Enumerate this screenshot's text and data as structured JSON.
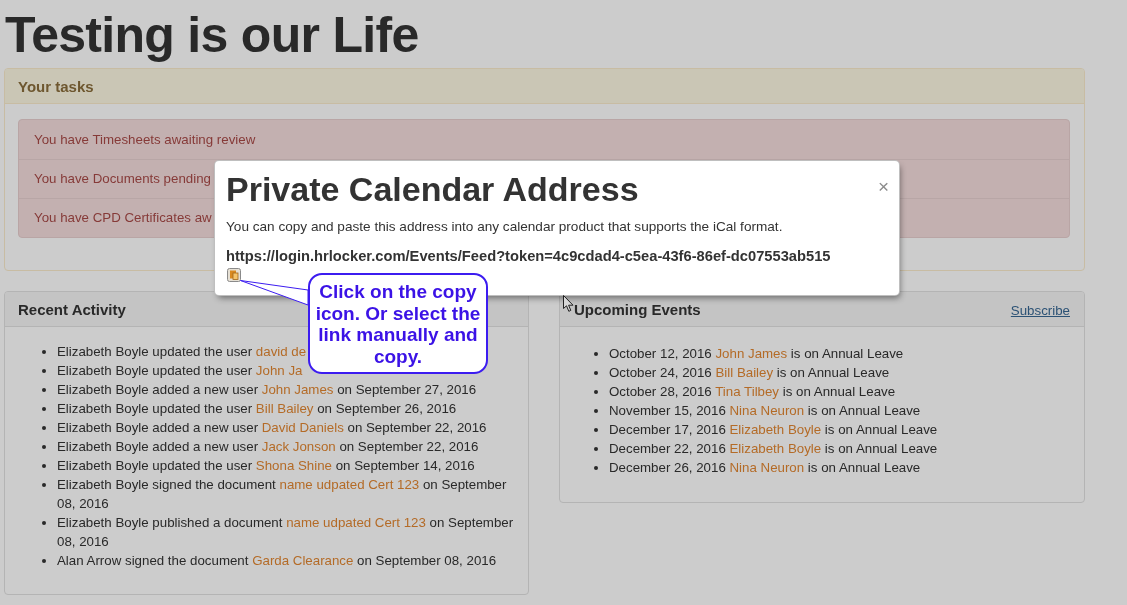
{
  "page": {
    "title": "Testing is our Life"
  },
  "tasks": {
    "title": "Your tasks",
    "items": [
      "You have Timesheets awaiting review",
      "You have Documents pending",
      "You have CPD Certificates aw"
    ]
  },
  "recent_activity": {
    "title": "Recent Activity",
    "items": [
      {
        "before": "Elizabeth Boyle updated the user",
        "link": "david de"
      },
      {
        "before": "Elizabeth Boyle updated the user",
        "link": "John Ja"
      },
      {
        "before": "Elizabeth Boyle added a new user",
        "link": "John James",
        "after": "on September 27, 2016"
      },
      {
        "before": "Elizabeth Boyle updated the user",
        "link": "Bill Bailey",
        "after": "on September 26, 2016"
      },
      {
        "before": "Elizabeth Boyle added a new user",
        "link": "David Daniels",
        "after": "on September 22, 2016"
      },
      {
        "before": "Elizabeth Boyle added a new user",
        "link": "Jack Jonson",
        "after": "on September 22, 2016"
      },
      {
        "before": "Elizabeth Boyle updated the user",
        "link": "Shona Shine",
        "after": "on September 14, 2016"
      },
      {
        "before": "Elizabeth Boyle signed the document",
        "link": "name udpated Cert 123",
        "after": "on September 08, 2016"
      },
      {
        "before": "Elizabeth Boyle published a document",
        "link": "name udpated Cert 123",
        "after": "on September 08, 2016"
      },
      {
        "before": "Alan Arrow signed the document",
        "link": "Garda Clearance",
        "after": "on September 08, 2016"
      }
    ]
  },
  "upcoming_events": {
    "title": "Upcoming Events",
    "subscribe_link": "Subscribe",
    "items": [
      {
        "before": "October 12, 2016",
        "link": "John James",
        "after": "is on Annual Leave"
      },
      {
        "before": "October 24, 2016",
        "link": "Bill Bailey",
        "after": "is on Annual Leave"
      },
      {
        "before": "October 28, 2016",
        "link": "Tina Tilbey",
        "after": "is on Annual Leave"
      },
      {
        "before": "November 15, 2016",
        "link": "Nina Neuron",
        "after": "is on Annual Leave"
      },
      {
        "before": "December 17, 2016",
        "link": "Elizabeth Boyle",
        "after": "is on Annual Leave"
      },
      {
        "before": "December 22, 2016",
        "link": "Elizabeth Boyle",
        "after": "is on Annual Leave"
      },
      {
        "before": "December 26, 2016",
        "link": "Nina Neuron",
        "after": "is on Annual Leave"
      }
    ]
  },
  "modal": {
    "title": "Private Calendar Address",
    "close": "×",
    "description": "You can copy and paste this address into any calendar product that supports the iCal format.",
    "url": "https://login.hrlocker.com/Events/Feed?token=4c9cdad4-c5ea-43f6-86ef-dc07553ab515"
  },
  "callout": {
    "text": "Click on the copy icon. Or select the link manually and copy."
  }
}
